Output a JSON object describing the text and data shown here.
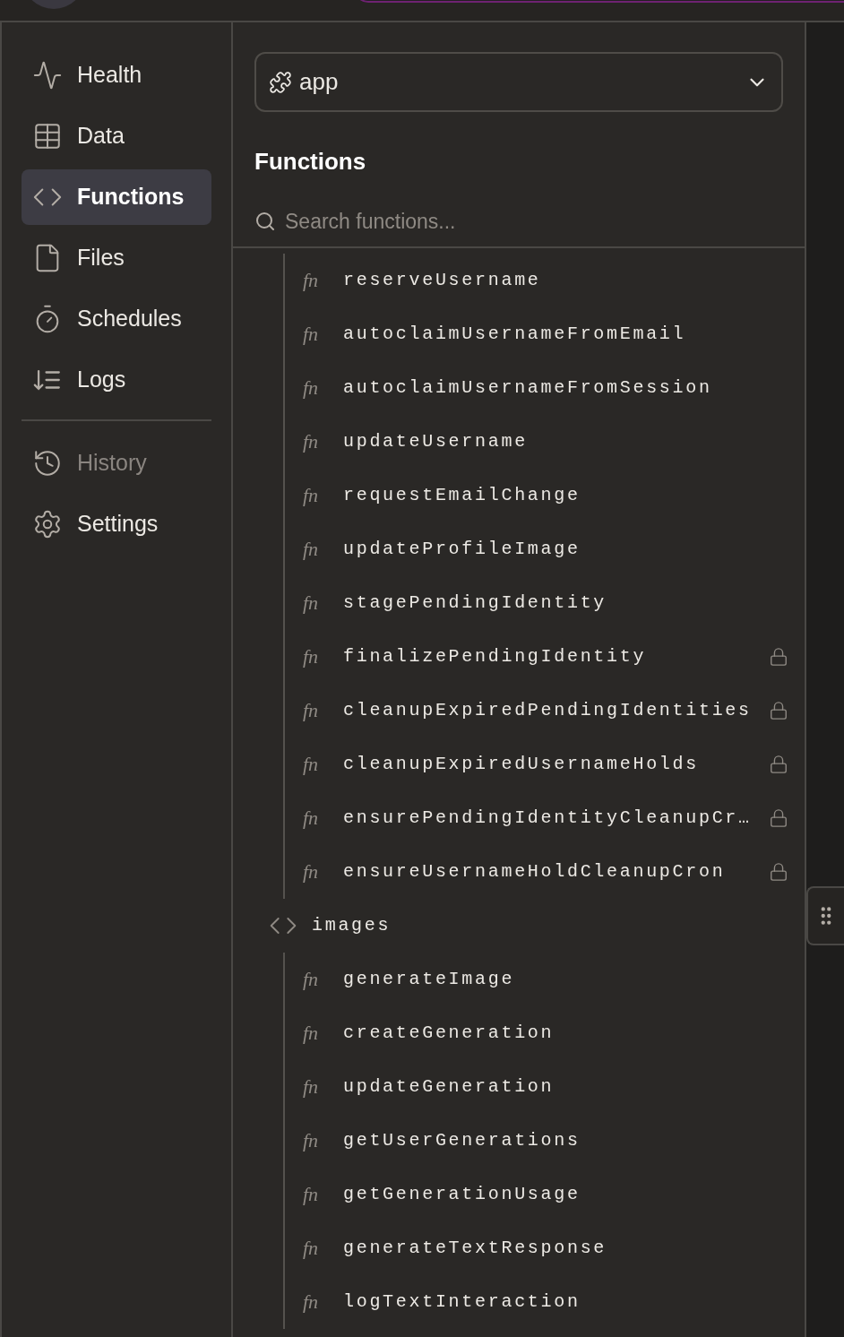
{
  "sidebar": {
    "items": [
      {
        "label": "Health",
        "kind": "health",
        "selected": false,
        "disabled": false
      },
      {
        "label": "Data",
        "kind": "data",
        "selected": false,
        "disabled": false
      },
      {
        "label": "Functions",
        "kind": "functions",
        "selected": true,
        "disabled": false
      },
      {
        "label": "Files",
        "kind": "files",
        "selected": false,
        "disabled": false
      },
      {
        "label": "Schedules",
        "kind": "schedules",
        "selected": false,
        "disabled": false
      },
      {
        "label": "Logs",
        "kind": "logs",
        "selected": false,
        "disabled": false
      }
    ],
    "bottom_items": [
      {
        "label": "History",
        "kind": "history",
        "selected": false,
        "disabled": true
      },
      {
        "label": "Settings",
        "kind": "settings",
        "selected": false,
        "disabled": false
      }
    ]
  },
  "component_select": {
    "value": "app"
  },
  "heading": "Functions",
  "search": {
    "placeholder": "Search functions..."
  },
  "function_tree": [
    {
      "kind": "group",
      "children": [
        {
          "badge": "fn",
          "name": "reserveUsername",
          "locked": false
        },
        {
          "badge": "fn",
          "name": "autoclaimUsernameFromEmail",
          "locked": false
        },
        {
          "badge": "fn",
          "name": "autoclaimUsernameFromSession",
          "locked": false
        },
        {
          "badge": "fn",
          "name": "updateUsername",
          "locked": false
        },
        {
          "badge": "fn",
          "name": "requestEmailChange",
          "locked": false
        },
        {
          "badge": "fn",
          "name": "updateProfileImage",
          "locked": false
        },
        {
          "badge": "fn",
          "name": "stagePendingIdentity",
          "locked": false
        },
        {
          "badge": "fn",
          "name": "finalizePendingIdentity",
          "locked": true
        },
        {
          "badge": "fn",
          "name": "cleanupExpiredPendingIdentities",
          "locked": true
        },
        {
          "badge": "fn",
          "name": "cleanupExpiredUsernameHolds",
          "locked": true
        },
        {
          "badge": "fn",
          "name": "ensurePendingIdentityCleanupCr…",
          "locked": true
        },
        {
          "badge": "fn",
          "name": "ensureUsernameHoldCleanupCron",
          "locked": true
        }
      ]
    },
    {
      "kind": "module",
      "name": "images",
      "children": [
        {
          "badge": "fn",
          "name": "generateImage",
          "locked": false
        },
        {
          "badge": "fn",
          "name": "createGeneration",
          "locked": false
        },
        {
          "badge": "fn",
          "name": "updateGeneration",
          "locked": false
        },
        {
          "badge": "fn",
          "name": "getUserGenerations",
          "locked": false
        },
        {
          "badge": "fn",
          "name": "getGenerationUsage",
          "locked": false
        },
        {
          "badge": "fn",
          "name": "generateTextResponse",
          "locked": false
        },
        {
          "badge": "fn",
          "name": "logTextInteraction",
          "locked": false
        }
      ]
    }
  ]
}
